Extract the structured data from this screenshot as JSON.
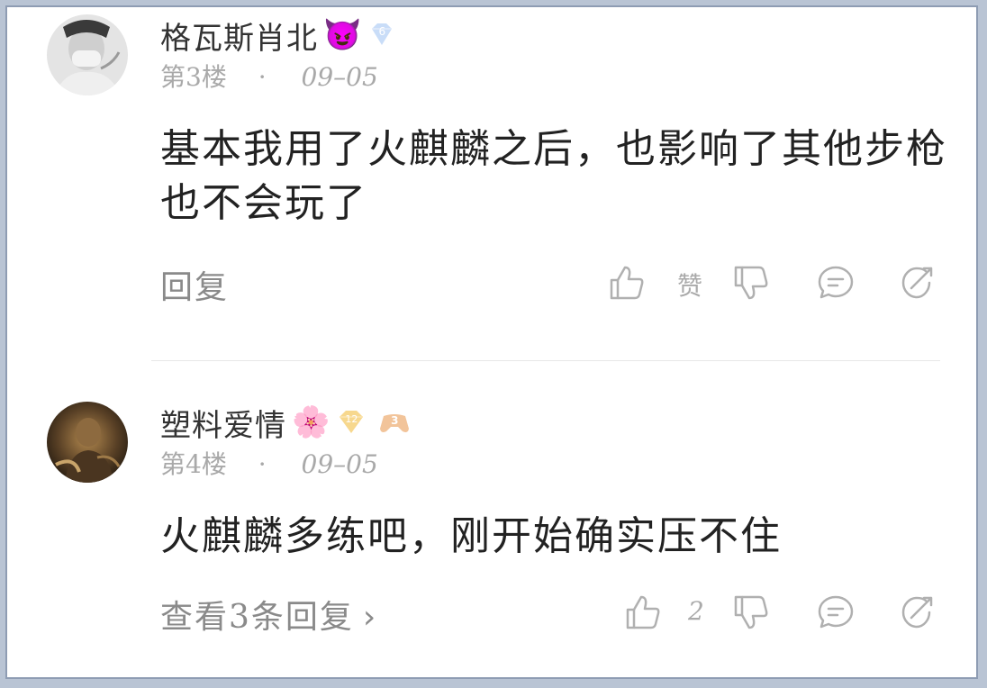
{
  "comments": [
    {
      "username": "格瓦斯肖北",
      "emoji": "😈",
      "level": "6",
      "floor": "第3楼",
      "separator": "·",
      "date": "09–05",
      "text": "基本我用了火麒麟之后，也影响了其他步枪也不会玩了",
      "reply_label": "回复",
      "like_label": "赞"
    },
    {
      "username": "塑料爱情",
      "emoji": "🌸",
      "level": "12",
      "fan_badge": "3",
      "floor": "第4楼",
      "separator": "·",
      "date": "09–05",
      "text": "火麒麟多练吧，刚开始确实压不住",
      "reply_label": "查看3条回复",
      "reply_arrow": "›",
      "like_label": "2"
    }
  ],
  "colors": {
    "level_blue": "#b9d4f6",
    "level_gold": "#f7d88e",
    "icon_gray": "#b0b0b0"
  }
}
